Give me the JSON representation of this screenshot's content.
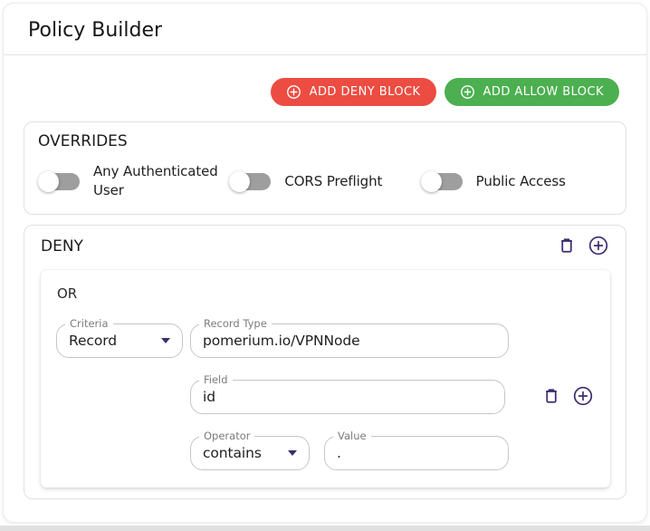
{
  "page": {
    "title": "Policy Builder"
  },
  "toolbar": {
    "add_deny_label": "ADD DENY BLOCK",
    "add_allow_label": "ADD ALLOW BLOCK",
    "deny_color": "#ec4c41",
    "allow_color": "#4caf50"
  },
  "overrides": {
    "title": "OVERRIDES",
    "toggles": [
      {
        "label": "Any Authenticated User",
        "state": "off"
      },
      {
        "label": "CORS Preflight",
        "state": "off"
      },
      {
        "label": "Public Access",
        "state": "off"
      }
    ]
  },
  "deny": {
    "title": "DENY",
    "group_operator": "OR",
    "criteria": {
      "label": "Criteria",
      "value": "Record"
    },
    "record_type": {
      "label": "Record Type",
      "value": "pomerium.io/VPNNode"
    },
    "field": {
      "label": "Field",
      "value": "id"
    },
    "operator": {
      "label": "Operator",
      "value": "contains"
    },
    "value": {
      "label": "Value",
      "value": "."
    }
  },
  "colors": {
    "icon_accent": "#3d2c6d",
    "toggle_track_off": "#9e9e9e",
    "input_border": "#c6c6c6",
    "box_border": "#e0e0e0",
    "text": "#1f1f1f",
    "floating_label": "#7b7b7b"
  }
}
